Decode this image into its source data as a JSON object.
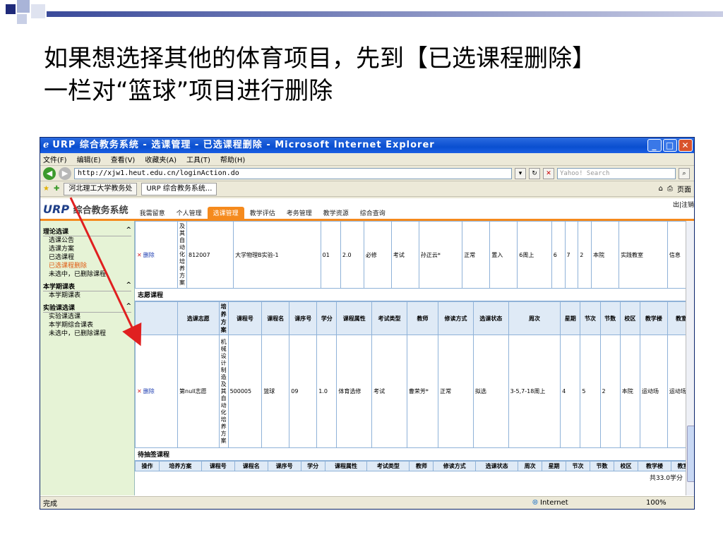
{
  "slide": {
    "title_line1": "如果想选择其他的体育项目，先到【已选课程删除】",
    "title_line2": "一栏对“篮球”项目进行删除"
  },
  "window": {
    "title": "URP 综合教务系统 - 选课管理 - 已选课程删除 - Microsoft Internet Explorer",
    "ie_glyph": "ℯ",
    "min": "_",
    "max": "□",
    "close": "✕"
  },
  "menu": [
    "文件(F)",
    "编辑(E)",
    "查看(V)",
    "收藏夹(A)",
    "工具(T)",
    "帮助(H)"
  ],
  "address": {
    "url": "http://xjw1.heut.edu.cn/loginAction.do",
    "search_placeholder": "Yahoo! Search"
  },
  "favbar": {
    "fav1": "河北理工大学教务处",
    "tab": "URP 综合教务系统...",
    "page": "页面"
  },
  "site": {
    "logo_en": "URP",
    "logo_cn": "综合教务系统",
    "nav": [
      "我需留意",
      "个人管理",
      "选课管理",
      "教学评估",
      "考务管理",
      "教学资源",
      "综合查询"
    ],
    "logout": "出|注销"
  },
  "sidebar": {
    "sections": [
      {
        "title": "理论选课",
        "items": [
          "选课公告",
          "选课方案",
          "已选课程",
          "已选课程删除",
          "未选中，已删除课程"
        ]
      },
      {
        "title": "本学期课表",
        "items": [
          "本学期课表"
        ]
      },
      {
        "title": "实验课选课",
        "items": [
          "实验课选课",
          "本学期综合课表",
          "未选中，已删除课程"
        ]
      }
    ]
  },
  "top_row": {
    "action": "删除",
    "plan": "及其自动化培养方案",
    "course_no": "812007",
    "course_name": "大学物理B实验-1",
    "seq": "01",
    "credit": "2.0",
    "attr": "必修",
    "exam": "考试",
    "teacher": "孙正云*",
    "study": "正常",
    "status": "置入",
    "weeks": "6周上",
    "day": "6",
    "period": "7",
    "count": "2",
    "campus": "本院",
    "building": "实践教室",
    "room": "信息"
  },
  "vol": {
    "section": "志愿课程",
    "headers": [
      "",
      "选课志愿",
      "培养方案",
      "课程号",
      "课程名",
      "课序号",
      "学分",
      "课程属性",
      "考试类型",
      "教师",
      "修读方式",
      "选课状态",
      "周次",
      "星期",
      "节次",
      "节数",
      "校区",
      "教学楼",
      "教室"
    ],
    "row": {
      "action": "删除",
      "wish": "第null志愿",
      "plan": "机械设计制造及其自动化培养方案",
      "course_no": "500005",
      "course_name": "篮球",
      "seq": "09",
      "credit": "1.0",
      "attr": "体育选修",
      "exam": "考试",
      "teacher": "曹荣芳*",
      "study": "正常",
      "status": "拟选",
      "weeks": "3-5,7-18周上",
      "day": "4",
      "period": "5",
      "count": "2",
      "campus": "本院",
      "building": "运动场",
      "room": "运动场"
    }
  },
  "pending": {
    "section": "待抽签课程",
    "headers": [
      "操作",
      "培养方案",
      "课程号",
      "课程名",
      "课序号",
      "学分",
      "课程属性",
      "考试类型",
      "教师",
      "修读方式",
      "选课状态",
      "周次",
      "星期",
      "节次",
      "节数",
      "校区",
      "教学楼",
      "教室"
    ],
    "total": "共33.0学分"
  },
  "status": {
    "left": "完成",
    "zone": "Internet",
    "zoom": "100%"
  },
  "colors": {
    "accent": "#f58a1d",
    "sidebar": "#e6f3d6",
    "arrow": "#e02020"
  }
}
